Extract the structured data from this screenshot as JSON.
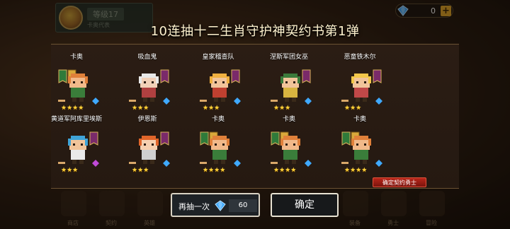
{
  "header": {
    "title": "10连抽十二生肖守护神契约书第1弹",
    "player_level": "等级17",
    "player_sub": "卡奥代表",
    "gems": "0",
    "plus": "+"
  },
  "heroes": [
    {
      "name": "卡奥",
      "stars": "★★★★"
    },
    {
      "name": "吸血鬼",
      "stars": "★★★"
    },
    {
      "name": "皇家稽查队",
      "stars": "★★★"
    },
    {
      "name": "涅斯军团女巫",
      "stars": "★★★"
    },
    {
      "name": "恶童铁木尔",
      "stars": "★★★"
    },
    {
      "name": "黄道军阿库里埃斯",
      "stars": "★★★"
    },
    {
      "name": "伊恩斯",
      "stars": "★★★"
    },
    {
      "name": "卡奥",
      "stars": "★★★★"
    },
    {
      "name": "卡奥",
      "stars": "★★★★"
    },
    {
      "name": "卡奥",
      "stars": "★★★★"
    }
  ],
  "confirm_tag": "确定契约勇士",
  "buttons": {
    "again_label": "再抽一次",
    "again_cost": "60",
    "ok_label": "确定"
  },
  "nav": [
    "商店",
    "契约",
    "英雄",
    "",
    "",
    "装备",
    "勇士",
    "冒险"
  ],
  "colors": {
    "gold_star": "#ffd23a",
    "gem": "#3fa9ff",
    "tag_red": "#b8261a"
  }
}
